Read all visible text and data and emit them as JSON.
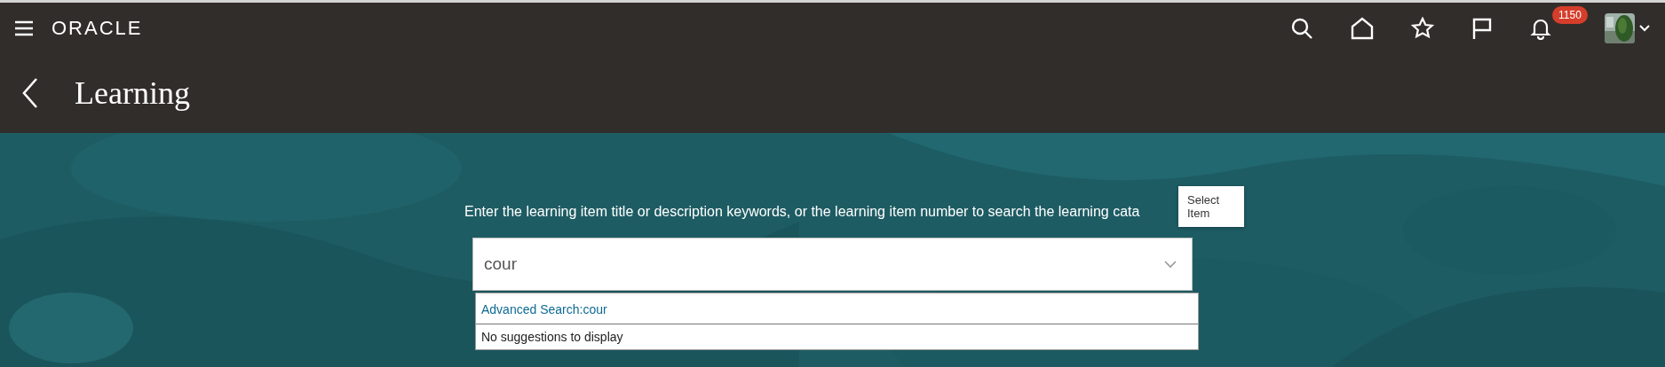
{
  "header": {
    "brand": "ORACLE",
    "notifications": {
      "count": "1150"
    }
  },
  "page": {
    "title": "Learning"
  },
  "search": {
    "instructions": "Enter the learning item title or description keywords, or the learning item number to search the learning cata",
    "value": "cour",
    "tooltip": "Select Item",
    "suggestions": [
      {
        "kind": "link",
        "text": "Advanced Search:cour"
      },
      {
        "kind": "message",
        "text": "No suggestions to display"
      }
    ]
  }
}
